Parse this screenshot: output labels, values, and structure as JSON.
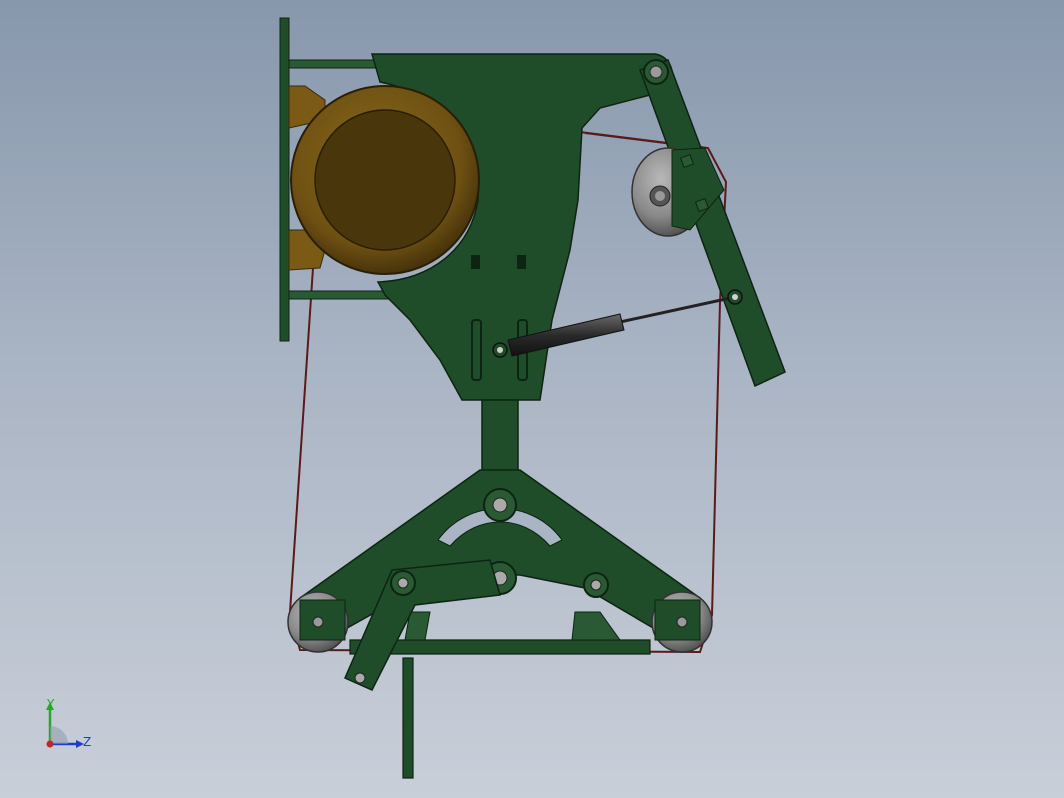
{
  "viewport": {
    "background_top": "#8797ac",
    "background_bottom": "#c9cfd9"
  },
  "model": {
    "frame_color": "#1f4d2a",
    "frame_edge_color": "#0d2413",
    "motor_color": "#7a5a14",
    "roller_color": "#8a8a8a",
    "belt_color": "#5a1a1a"
  },
  "triad": {
    "y_axis_label": "Y",
    "z_axis_label": "Z",
    "y_color": "#2aa52a",
    "z_color": "#1e3ec7",
    "x_color": "#c0272d"
  }
}
